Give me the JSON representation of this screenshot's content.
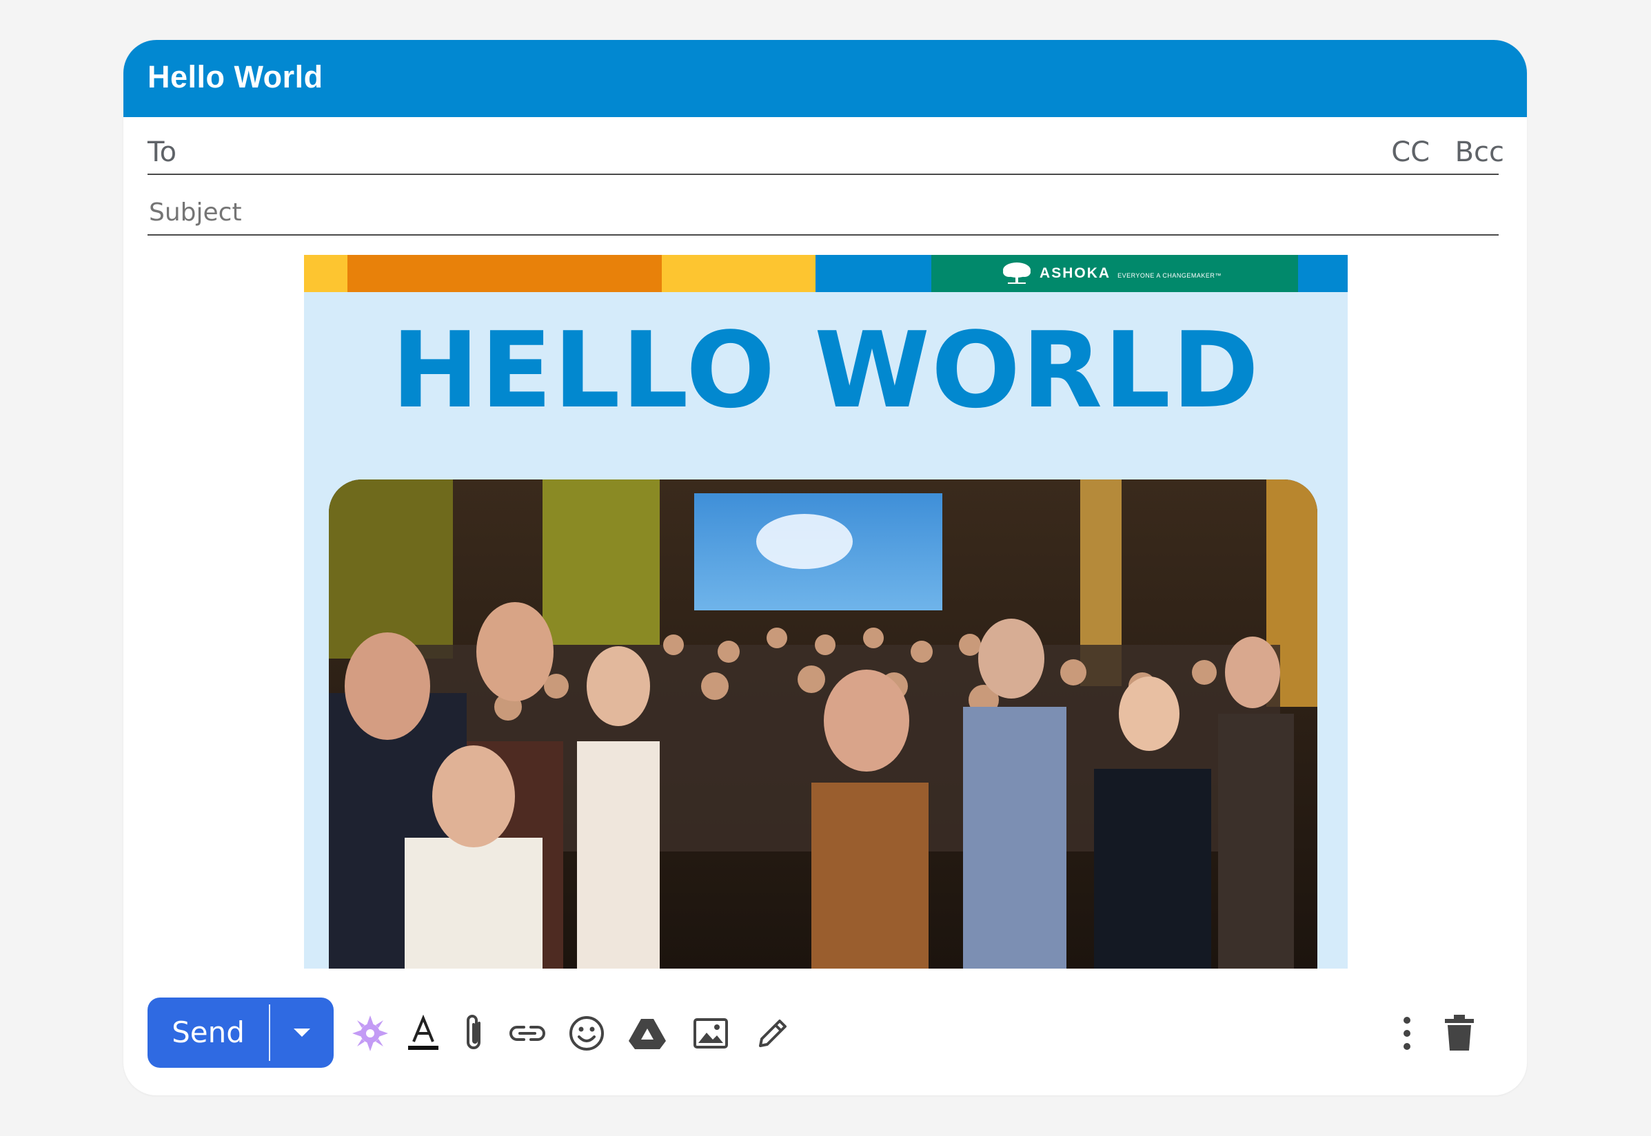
{
  "window": {
    "title": "Hello World"
  },
  "compose": {
    "to_label": "To",
    "cc_label": "CC",
    "bcc_label": "Bcc",
    "subject_placeholder": "Subject"
  },
  "newsletter": {
    "brand_name": "ASHOKA",
    "brand_tagline": "EVERYONE A CHANGEMAKER™",
    "headline": "HELLO WORLD",
    "photo": "group-photo-of-event-attendees",
    "colors": {
      "yellow": "#fdc530",
      "orange": "#e8810a",
      "blue": "#0288d1",
      "green": "#01896b",
      "background": "#d5ebfa",
      "headline": "#0288cf"
    }
  },
  "toolbar": {
    "send_label": "Send",
    "icons": [
      "more-send-options-icon",
      "ai-sparkle-icon",
      "text-format-icon",
      "attach-file-icon",
      "insert-link-icon",
      "emoji-icon",
      "drive-icon",
      "insert-photo-icon",
      "signature-pen-icon",
      "more-options-icon",
      "discard-trash-icon"
    ]
  },
  "colors": {
    "header": "#0288d1",
    "send": "#2f6ae2",
    "sparkle": "#c39bf5"
  }
}
